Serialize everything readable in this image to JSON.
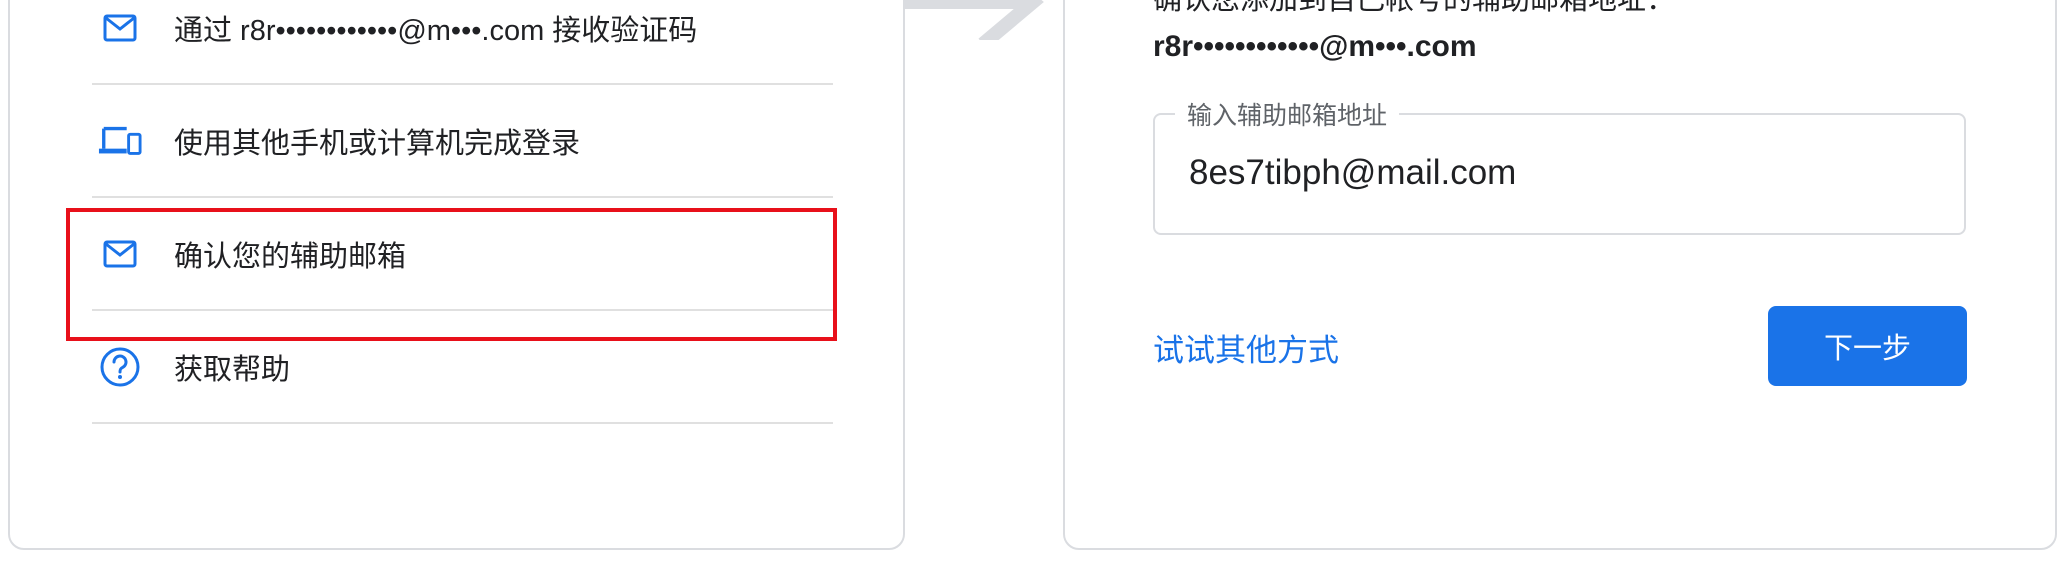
{
  "left_panel": {
    "options": [
      {
        "icon": "mail-icon",
        "label": "通过 r8r••••••••••••@m•••.com 接收验证码"
      },
      {
        "icon": "devices-icon",
        "label": "使用其他手机或计算机完成登录"
      },
      {
        "icon": "mail-icon",
        "label": "确认您的辅助邮箱",
        "highlighted": true
      },
      {
        "icon": "help-circle-icon",
        "label": "获取帮助"
      }
    ]
  },
  "right_panel": {
    "prompt": "确认您添加到自己帐号的辅助邮箱地址：",
    "masked_email": "r8r••••••••••••@m•••.com",
    "field": {
      "label": "输入辅助邮箱地址",
      "value": "8es7tibph@mail.com"
    },
    "try_other_link": "试试其他方式",
    "next_button": "下一步"
  },
  "colors": {
    "accent": "#1a73e8",
    "highlight_border": "#e8101a",
    "divider": "#e0e0e0",
    "card_border": "#dadce0"
  }
}
